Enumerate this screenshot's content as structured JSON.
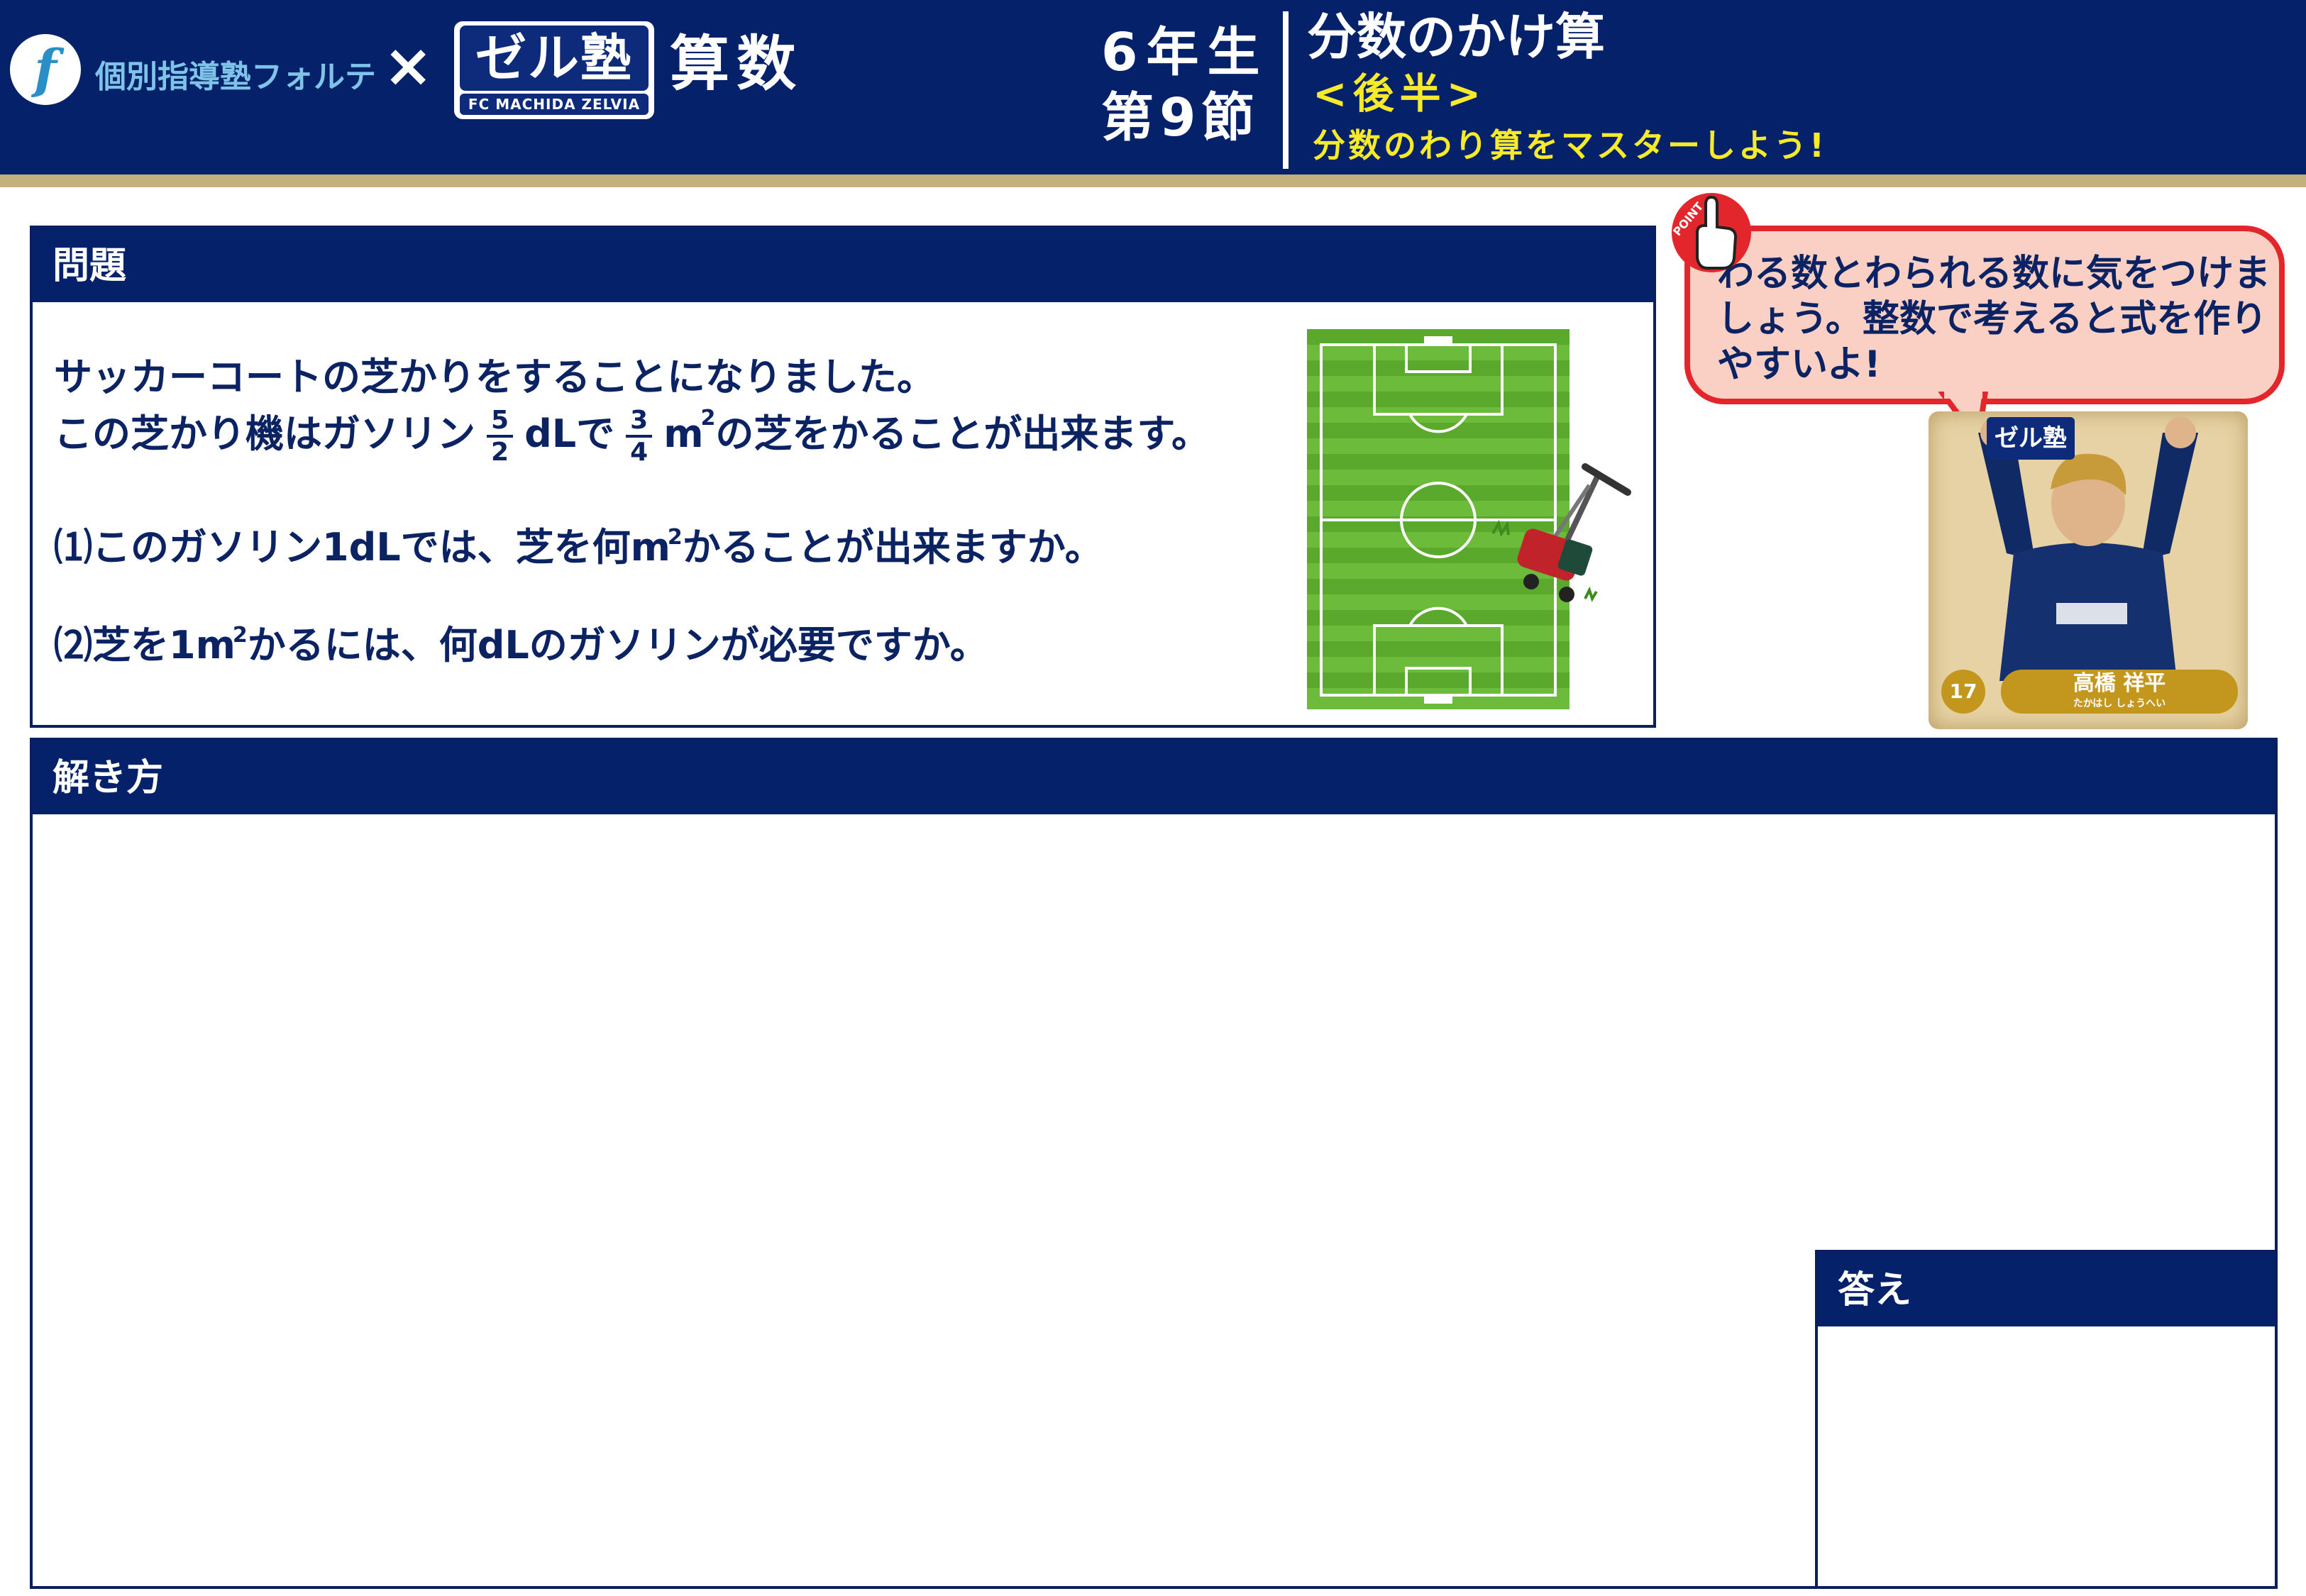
{
  "header": {
    "logo_letter": "f",
    "school_name": "個別指導塾フォルテ",
    "collab_mark": "×",
    "partner_logo_text": "ゼル塾",
    "partner_logo_sub": "FC MACHIDA ZELVIA",
    "subject": "算数",
    "grade": "6年生",
    "section": "第9節",
    "unit_title": "分数のかけ算",
    "unit_part": "<後半>",
    "unit_goal": "分数のわり算をマスターしよう!"
  },
  "problem": {
    "heading": "問題",
    "line1": "サッカーコートの芝かりをすることになりました。",
    "line2_pre": "この芝かり機はガソリン",
    "frac1_num": "5",
    "frac1_den": "2",
    "line2_mid": "dLで",
    "frac2_num": "3",
    "frac2_den": "4",
    "unit_m": "m",
    "unit_sq": "2",
    "line2_post": "の芝をかることが出来ます。",
    "q1_pre": "⑴このガソリン1dLでは、芝を何m",
    "q1_post": "かることが出来ますか。",
    "q2_pre": "⑵芝を1m",
    "q2_post": "かるには、何dLのガソリンが必要ですか。"
  },
  "hint": {
    "icon_label": "POINT",
    "text": "わる数とわられる数に気をつけましょう。整数で考えると式を作りやすいよ!"
  },
  "player_card": {
    "badge": "ゼル塾",
    "number": "17",
    "name": "高橋 祥平",
    "kana": "たかはし しょうへい"
  },
  "solution": {
    "heading": "解き方"
  },
  "answer": {
    "heading": "答え"
  },
  "colors": {
    "navy": "#04216a",
    "gold": "#c4b07c",
    "yellow_text": "#f6ea2a",
    "bubble_border": "#e3262c",
    "bubble_fill": "#fbd0c4",
    "field_green": "#6dbb3a"
  }
}
